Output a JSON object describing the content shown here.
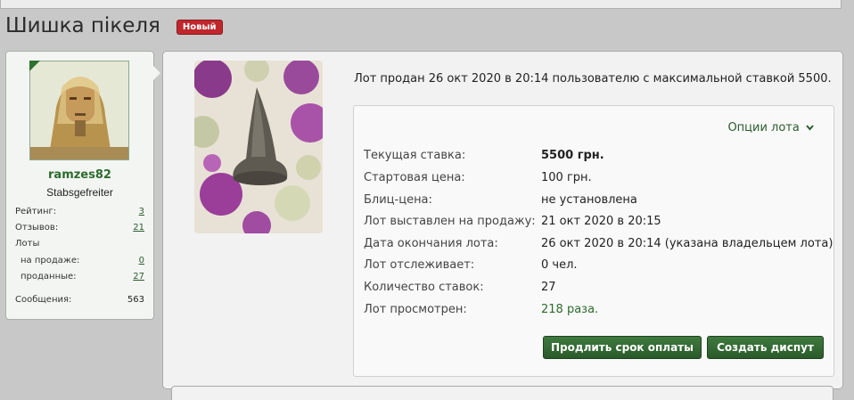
{
  "thread": {
    "title": "Шишка пікеля",
    "badge": "Новый"
  },
  "user": {
    "name": "ramzes82",
    "rank": "Stabsgefreiter",
    "stats": {
      "rating_label": "Рейтинг:",
      "rating": "3",
      "reviews_label": "Отзывов:",
      "reviews": "21",
      "lots_label": "Лоты",
      "on_sale_label": "на продаже:",
      "on_sale": "0",
      "sold_label": "проданные:",
      "sold": "27",
      "messages_label": "Сообщения:",
      "messages": "563"
    }
  },
  "lot": {
    "sold_message": "Лот продан 26 окт 2020 в 20:14 пользователю с максимальной ставкой 5500.",
    "options_label": "Опции лота",
    "rows": [
      {
        "label": "Текущая ставка:",
        "value": "5500 грн."
      },
      {
        "label": "Стартовая цена:",
        "value": "100 грн."
      },
      {
        "label": "Блиц-цена:",
        "value": "не установлена"
      },
      {
        "label": "Лот выставлен на продажу:",
        "value": "21 окт 2020 в 20:15"
      },
      {
        "label": "Дата окончания лота:",
        "value": "26 окт 2020 в 20:14 (указана владельцем лота)"
      },
      {
        "label": "Лот отслеживает:",
        "value": "0 чел."
      },
      {
        "label": "Количество ставок:",
        "value": "27"
      },
      {
        "label": "Лот просмотрен:",
        "value": "218 раза."
      }
    ],
    "buttons": {
      "extend": "Продлить срок оплаты",
      "dispute": "Создать диспут"
    }
  },
  "icons": {
    "options": "chevron-down-icon",
    "online": "online-indicator"
  },
  "colors": {
    "accent_green": "#2c6b2c",
    "badge_red": "#c0272d",
    "button_green": "#3f7a3f"
  }
}
